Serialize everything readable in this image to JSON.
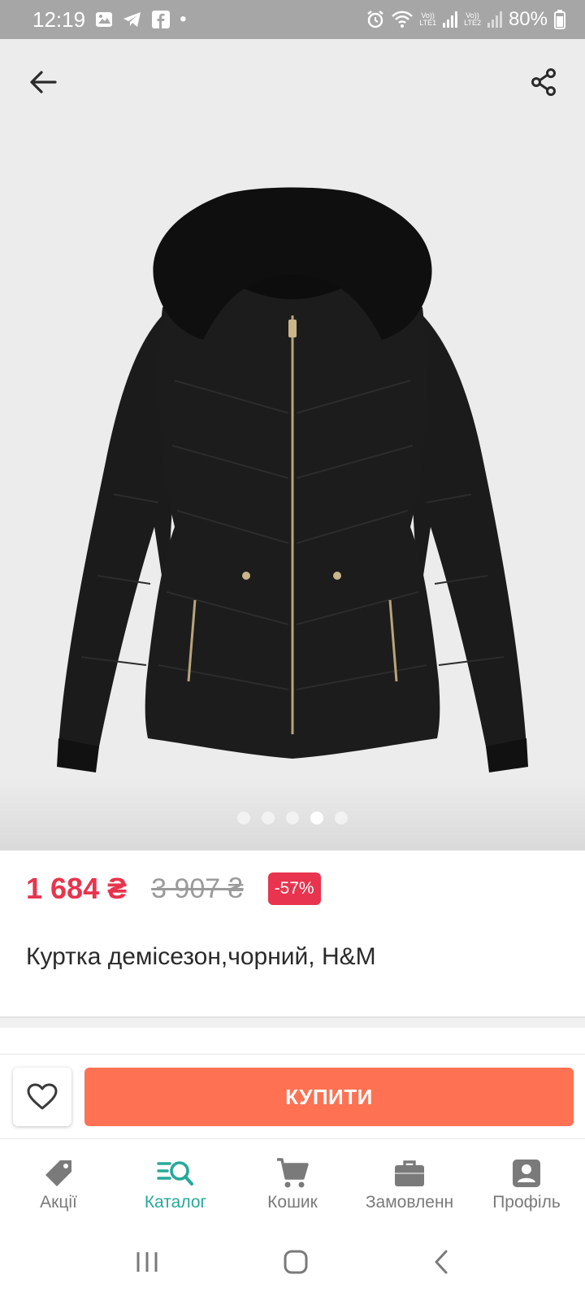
{
  "status_bar": {
    "time": "12:19",
    "battery": "80%",
    "sim1_label": "LTE1",
    "sim2_label": "LTE2",
    "sim_vo_label": "Vo))",
    "dot": "•",
    "icons": [
      "image-icon",
      "telegram-icon",
      "facebook-icon",
      "alarm-icon",
      "wifi-icon",
      "signal-icon",
      "battery-icon"
    ]
  },
  "gallery": {
    "slides": 5,
    "active_index": 3
  },
  "product": {
    "price_current": "1 684 ₴",
    "price_old": "3 907 ₴",
    "discount": "-57%",
    "title": "Куртка демісезон,чорний, H&M"
  },
  "actions": {
    "buy_label": "КУПИТИ"
  },
  "bottom_nav": {
    "items": [
      {
        "label": "Акції",
        "icon": "tag-icon"
      },
      {
        "label": "Каталог",
        "icon": "catalog-search-icon",
        "active": true
      },
      {
        "label": "Кошик",
        "icon": "cart-icon"
      },
      {
        "label": "Замовленн",
        "icon": "briefcase-icon"
      },
      {
        "label": "Профіль",
        "icon": "profile-icon"
      }
    ]
  },
  "colors": {
    "accent": "#26a99a",
    "price": "#e8344e",
    "buy": "#fe7253",
    "status_bar": "#a6a6a6"
  }
}
